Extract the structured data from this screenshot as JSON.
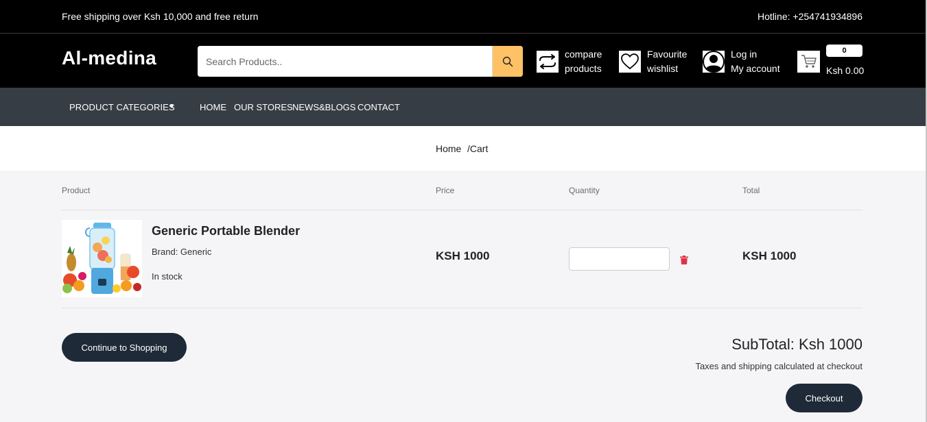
{
  "topbar": {
    "promo": "Free shipping over Ksh 10,000 and free return",
    "hotline": "Hotline: +254741934896"
  },
  "header": {
    "logo": "Al-medina",
    "search_placeholder": "Search Products..",
    "compare": {
      "line1": "compare",
      "line2": "products",
      "icon": "compare-arrows-icon"
    },
    "wishlist": {
      "line1": "Favourite",
      "line2": "wishlist",
      "icon": "heart-icon"
    },
    "account": {
      "line1": "Log in",
      "line2": "My account",
      "icon": "user-icon"
    },
    "cart": {
      "count": "0",
      "total": "Ksh 0.00",
      "icon": "cart-icon"
    },
    "accent_color": "#ffc166"
  },
  "nav": {
    "categories": "PRODUCT CATEGORIES",
    "links": [
      "HOME",
      "OUR STORES",
      "NEWS&BLOGS",
      "CONTACT"
    ]
  },
  "breadcrumb": {
    "home": "Home",
    "current": "/Cart"
  },
  "cart_table": {
    "headers": {
      "product": "Product",
      "price": "Price",
      "quantity": "Quantity",
      "total": "Total"
    },
    "items": [
      {
        "name": "Generic Portable Blender",
        "brand": "Brand: Generic",
        "stock": "In stock",
        "price": "KSH 1000",
        "quantity": "",
        "total": "KSH 1000"
      }
    ]
  },
  "summary": {
    "continue_label": "Continue to Shopping",
    "subtotal": "SubTotal: Ksh 1000",
    "taxes_note": "Taxes and shipping calculated at checkout",
    "checkout_label": "Checkout",
    "button_color": "#1f2a38",
    "delete_color": "#dc3545"
  }
}
